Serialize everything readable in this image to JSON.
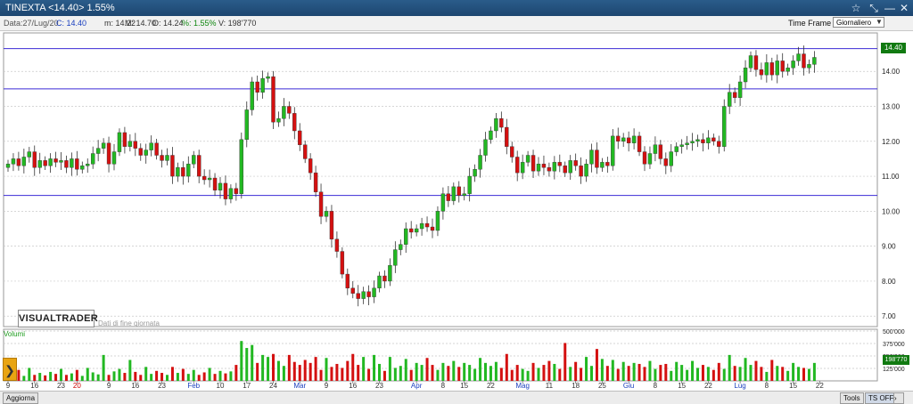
{
  "window": {
    "title": "TINEXTA <14.40> 1.55%"
  },
  "infobar": {
    "date": "Data:27/Lug/20",
    "close": "C: 14.40",
    "min": "m: 14.22",
    "max": "M: 14.70",
    "open": "O: 14.24",
    "pct": "%: 1.55%",
    "volume": "V: 198'770"
  },
  "timeframe": {
    "label": "Time Frame",
    "value": "Giornaliero"
  },
  "branding": {
    "logo": "VISUALTRADER",
    "subtitle": "Dati di fine giornata"
  },
  "volume_panel": {
    "label": "Volumi",
    "tag": "198'770"
  },
  "price_tag": "14.40",
  "bottom": {
    "update": "Aggiorna",
    "tools": "Tools",
    "ts": "TS OFF"
  },
  "chart_data": {
    "type": "candlestick",
    "y_ticks": [
      "14.00",
      "13.00",
      "12.00",
      "11.00",
      "10.00",
      "9.00",
      "8.00",
      "7.00"
    ],
    "ylim": [
      6.7,
      15.1
    ],
    "volume_ticks": [
      "500'000",
      "375'000",
      "250'000",
      "125'000"
    ],
    "volume_lim": [
      0,
      500000
    ],
    "x_ticks": [
      {
        "label": "9",
        "i": 0,
        "color": "#333333"
      },
      {
        "label": "16",
        "i": 5,
        "color": "#333333"
      },
      {
        "label": "23",
        "i": 10,
        "color": "#333333"
      },
      {
        "label": "20",
        "i": 13,
        "color": "#cc0000"
      },
      {
        "label": "9",
        "i": 19,
        "color": "#333333"
      },
      {
        "label": "16",
        "i": 24,
        "color": "#333333"
      },
      {
        "label": "23",
        "i": 29,
        "color": "#333333"
      },
      {
        "label": "Feb",
        "i": 35,
        "color": "#1a3fbf"
      },
      {
        "label": "10",
        "i": 40,
        "color": "#333333"
      },
      {
        "label": "17",
        "i": 45,
        "color": "#333333"
      },
      {
        "label": "24",
        "i": 50,
        "color": "#333333"
      },
      {
        "label": "Mar",
        "i": 55,
        "color": "#1a3fbf"
      },
      {
        "label": "9",
        "i": 60,
        "color": "#333333"
      },
      {
        "label": "16",
        "i": 65,
        "color": "#333333"
      },
      {
        "label": "23",
        "i": 70,
        "color": "#333333"
      },
      {
        "label": "Apr",
        "i": 77,
        "color": "#1a3fbf"
      },
      {
        "label": "8",
        "i": 82,
        "color": "#333333"
      },
      {
        "label": "15",
        "i": 86,
        "color": "#333333"
      },
      {
        "label": "22",
        "i": 91,
        "color": "#333333"
      },
      {
        "label": "Mag",
        "i": 97,
        "color": "#1a3fbf"
      },
      {
        "label": "11",
        "i": 102,
        "color": "#333333"
      },
      {
        "label": "18",
        "i": 107,
        "color": "#333333"
      },
      {
        "label": "25",
        "i": 112,
        "color": "#333333"
      },
      {
        "label": "Giu",
        "i": 117,
        "color": "#1a3fbf"
      },
      {
        "label": "8",
        "i": 122,
        "color": "#333333"
      },
      {
        "label": "15",
        "i": 127,
        "color": "#333333"
      },
      {
        "label": "22",
        "i": 132,
        "color": "#333333"
      },
      {
        "label": "Lug",
        "i": 138,
        "color": "#1a3fbf"
      },
      {
        "label": "8",
        "i": 143,
        "color": "#333333"
      },
      {
        "label": "15",
        "i": 148,
        "color": "#333333"
      },
      {
        "label": "22",
        "i": 153,
        "color": "#333333"
      }
    ],
    "hlines": [
      14.65,
      13.5,
      10.45
    ],
    "colors": {
      "up": "#22b822",
      "down": "#d41010",
      "hline": "#3b2bd6",
      "grid": "#c9c9c9"
    },
    "closes": [
      11.35,
      11.5,
      11.3,
      11.55,
      11.7,
      11.25,
      11.45,
      11.3,
      11.5,
      11.4,
      11.45,
      11.25,
      11.5,
      11.2,
      11.3,
      11.35,
      11.65,
      11.8,
      11.95,
      11.35,
      11.7,
      12.25,
      11.85,
      12.0,
      11.8,
      11.6,
      11.75,
      11.95,
      11.6,
      11.45,
      11.6,
      11.0,
      11.25,
      11.0,
      11.35,
      11.6,
      11.0,
      10.9,
      10.95,
      10.6,
      10.8,
      10.35,
      10.65,
      10.5,
      12.05,
      12.9,
      13.7,
      13.4,
      13.8,
      13.85,
      12.55,
      12.65,
      13.0,
      12.8,
      12.3,
      11.9,
      11.5,
      11.1,
      10.55,
      9.85,
      10.0,
      9.2,
      8.85,
      8.2,
      7.8,
      7.65,
      7.5,
      7.7,
      7.55,
      7.8,
      8.15,
      8.0,
      8.45,
      8.9,
      9.05,
      9.5,
      9.4,
      9.5,
      9.65,
      9.55,
      9.45,
      10.0,
      10.5,
      10.3,
      10.7,
      10.45,
      10.5,
      11.0,
      11.2,
      11.6,
      12.05,
      12.3,
      12.65,
      12.4,
      11.85,
      11.55,
      11.1,
      11.4,
      11.6,
      11.15,
      11.35,
      11.25,
      11.15,
      11.4,
      11.3,
      11.1,
      11.45,
      11.3,
      11.0,
      11.35,
      11.75,
      11.25,
      11.4,
      11.3,
      12.15,
      12.0,
      12.1,
      11.95,
      12.15,
      11.7,
      11.35,
      11.65,
      11.9,
      11.5,
      11.3,
      11.7,
      11.85,
      11.9,
      11.95,
      12.0,
      12.05,
      11.95,
      12.1,
      12.0,
      11.85,
      13.0,
      13.4,
      13.25,
      13.7,
      14.1,
      14.45,
      14.05,
      13.9,
      14.25,
      13.9,
      14.3,
      14.0,
      14.1,
      14.3,
      14.5,
      14.1,
      14.2,
      14.4
    ],
    "volumes": [
      90000,
      60000,
      110000,
      50000,
      130000,
      60000,
      80000,
      55000,
      90000,
      70000,
      120000,
      60000,
      75000,
      110000,
      50000,
      130000,
      85000,
      65000,
      260000,
      60000,
      95000,
      120000,
      80000,
      210000,
      90000,
      60000,
      140000,
      70000,
      100000,
      80000,
      60000,
      140000,
      80000,
      120000,
      70000,
      110000,
      60000,
      85000,
      130000,
      70000,
      100000,
      75000,
      95000,
      160000,
      400000,
      330000,
      360000,
      180000,
      260000,
      240000,
      270000,
      200000,
      150000,
      260000,
      190000,
      160000,
      210000,
      180000,
      240000,
      110000,
      230000,
      140000,
      170000,
      130000,
      200000,
      270000,
      160000,
      240000,
      120000,
      260000,
      170000,
      100000,
      240000,
      130000,
      150000,
      220000,
      110000,
      180000,
      160000,
      230000,
      160000,
      110000,
      180000,
      150000,
      200000,
      140000,
      180000,
      160000,
      120000,
      230000,
      180000,
      150000,
      190000,
      130000,
      270000,
      110000,
      160000,
      120000,
      100000,
      180000,
      130000,
      160000,
      200000,
      170000,
      120000,
      380000,
      140000,
      190000,
      130000,
      240000,
      150000,
      320000,
      220000,
      150000,
      210000,
      120000,
      190000,
      150000,
      180000,
      170000,
      140000,
      200000,
      120000,
      160000,
      170000,
      100000,
      190000,
      160000,
      110000,
      200000,
      130000,
      160000,
      140000,
      110000,
      180000,
      120000,
      260000,
      150000,
      140000,
      230000,
      160000,
      200000,
      140000,
      90000,
      210000,
      150000,
      140000,
      100000,
      180000,
      140000,
      130000,
      120000,
      180000,
      120000,
      200000
    ]
  }
}
